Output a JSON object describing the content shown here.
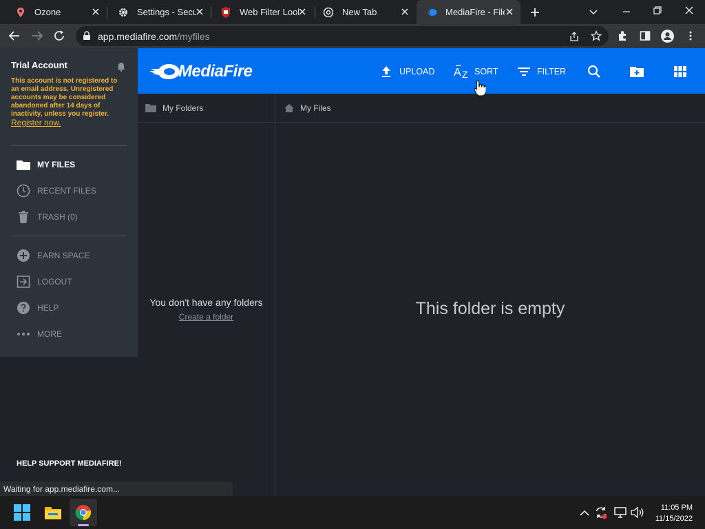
{
  "browser": {
    "tabs": [
      {
        "title": "Ozone",
        "icon": "map-pin-icon"
      },
      {
        "title": "Settings - Secur",
        "icon": "gear-icon"
      },
      {
        "title": "Web Filter Look",
        "icon": "shield-icon"
      },
      {
        "title": "New Tab",
        "icon": "chrome-icon"
      },
      {
        "title": "MediaFire - File",
        "icon": "mediafire-icon",
        "active": true
      }
    ],
    "url_host": "app.mediafire.com",
    "url_path": "/myfiles",
    "status": "Waiting for app.mediafire.com..."
  },
  "sidebar": {
    "account_title": "Trial Account",
    "notice": "This account is not registered to an email address. Unregistered accounts may be considered abandoned after 14 days of inactivity, unless you register.",
    "register_link": "Register now.",
    "nav": [
      {
        "label": "MY FILES",
        "icon": "folder-icon",
        "active": true
      },
      {
        "label": "RECENT FILES",
        "icon": "clock-icon"
      },
      {
        "label": "TRASH (0)",
        "icon": "trash-icon"
      }
    ],
    "nav2": [
      {
        "label": "EARN SPACE",
        "icon": "plus-circle-icon"
      },
      {
        "label": "LOGOUT",
        "icon": "logout-icon"
      },
      {
        "label": "HELP",
        "icon": "help-icon"
      },
      {
        "label": "MORE",
        "icon": "more-icon"
      }
    ],
    "support": "HELP SUPPORT MEDIAFIRE!"
  },
  "header": {
    "logo": "MediaFire",
    "upload": "UPLOAD",
    "sort": "SORT",
    "filter": "FILTER"
  },
  "folders": {
    "heading": "My Folders",
    "empty": "You don't have any folders",
    "create": "Create a folder"
  },
  "files": {
    "breadcrumb": "My Files",
    "empty": "This folder is empty"
  },
  "taskbar": {
    "time": "11:05 PM",
    "date": "11/15/2022"
  },
  "colors": {
    "brand_blue": "#0070f0",
    "sidebar_top": "#2d333b",
    "background": "#1f2329",
    "warning": "#f0b230"
  }
}
